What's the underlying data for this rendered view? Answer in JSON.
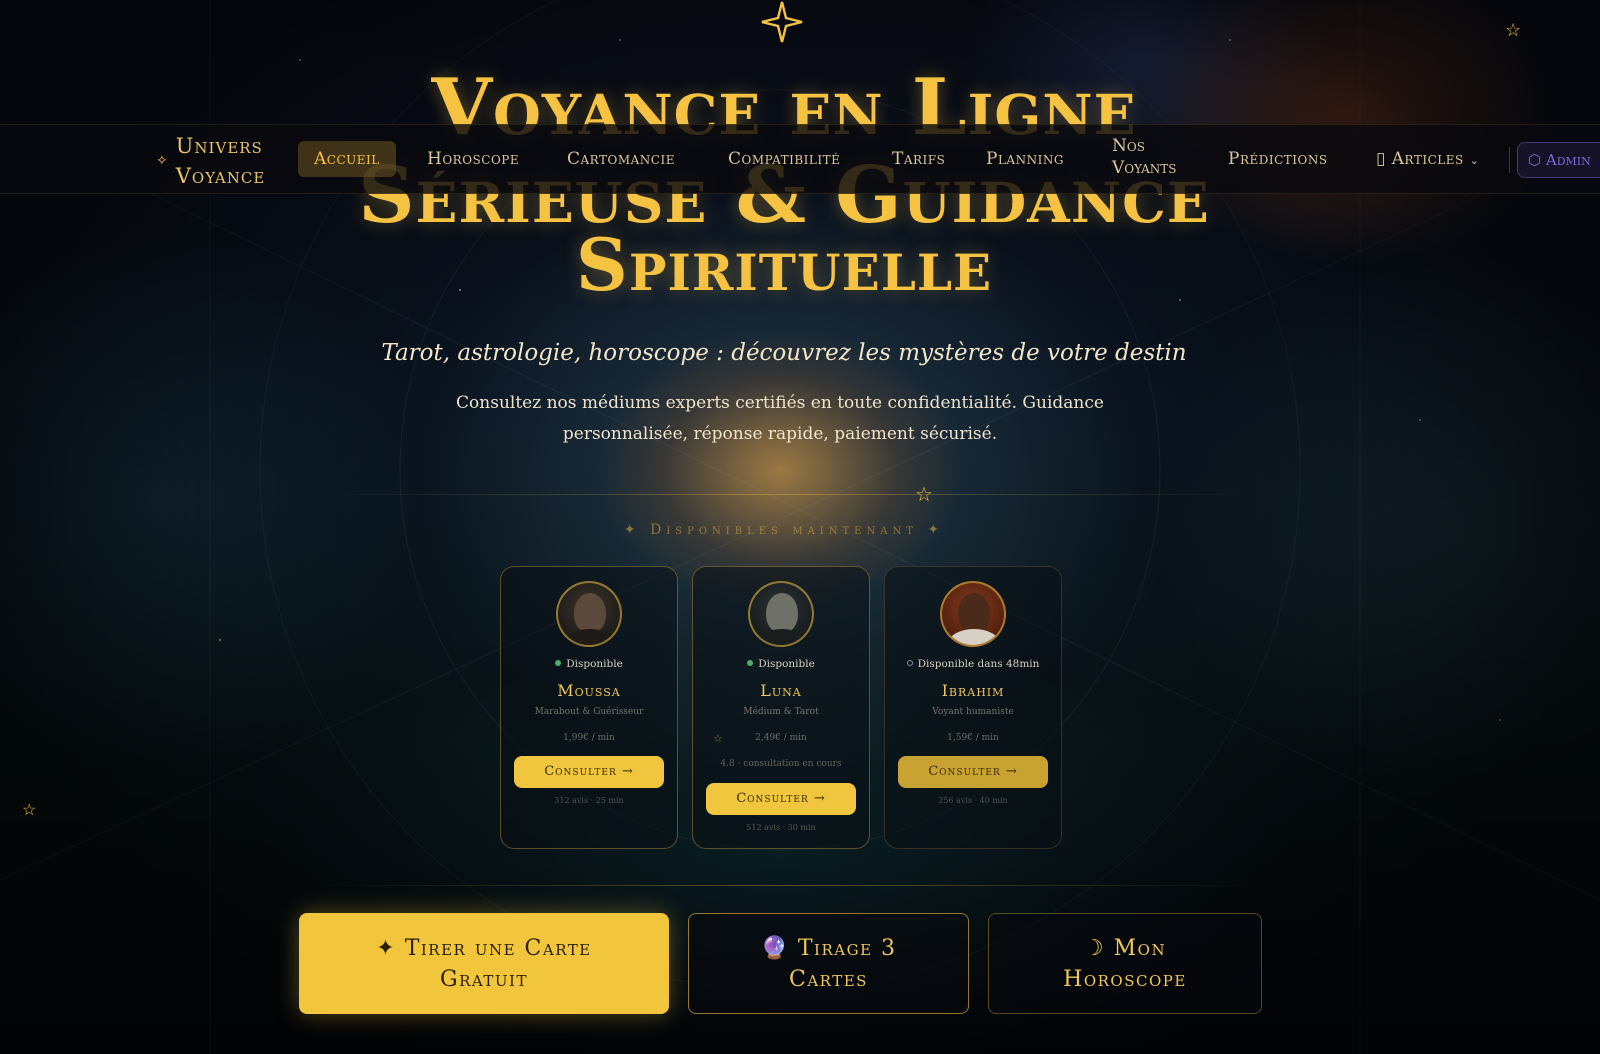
{
  "hero": {
    "title_line1": "Voyance en Ligne",
    "title_line2": "Sérieuse & Guidance",
    "title_line3": "Spirituelle",
    "tagline": "Tarot, astrologie, horoscope : découvrez les mystères de votre destin",
    "description": "Consultez nos médiums experts certifiés en toute confidentialité. Guidance personnalisée, réponse rapide, paiement sécurisé."
  },
  "navbar": {
    "brand_line1": "Univers",
    "brand_line2": "Voyance",
    "brand_icon": "sparkle-icon",
    "items": [
      {
        "label": "Accueil",
        "active": true
      },
      {
        "label": "Horoscope"
      },
      {
        "label": "Cartomancie"
      },
      {
        "label": "Compatibilité"
      },
      {
        "label": "Tarifs"
      },
      {
        "label": "Planning"
      },
      {
        "label_line1": "Nos",
        "label_line2": "Voyants"
      },
      {
        "label": "Prédictions"
      },
      {
        "label": "Articles",
        "icon": "book-icon",
        "caret": "chevron-down-icon"
      }
    ],
    "admin": {
      "label": "Admin",
      "icon": "shield-icon"
    }
  },
  "available": {
    "title": "✦ Disponibles maintenant ✦",
    "cards": [
      {
        "status": "Disponible",
        "status_color": "#4caf6a",
        "name": "Moussa",
        "role": "Marabout & Guérisseur",
        "price": "1,99€ / min",
        "button": "Consulter →",
        "stats": "312 avis · 25 min"
      },
      {
        "status": "Disponible",
        "status_color": "#4caf6a",
        "name": "Luna",
        "role": "Médium & Tarot",
        "price": "2,49€ / min",
        "rating": "4.8 · consultation en cours",
        "button": "Consulter →",
        "stats": "512 avis · 30 min"
      },
      {
        "status": "Disponible dans 48min",
        "status_color": "#8a8a8a",
        "name": "Ibrahim",
        "role": "Voyant humaniste",
        "price": "1,59€ / min",
        "button": "Consulter →",
        "stats": "256 avis · 40 min"
      }
    ]
  },
  "cta": {
    "primary_line1": "✦ Tirer une Carte",
    "primary_line2": "Gratuit",
    "second_line1": "🔮 Tirage 3",
    "second_line2": "Cartes",
    "third_line1": "☽ Mon",
    "third_line2": "Horoscope"
  },
  "colors": {
    "accent": "#f5c242",
    "background": "#05070d",
    "admin": "#7a6ad8"
  }
}
